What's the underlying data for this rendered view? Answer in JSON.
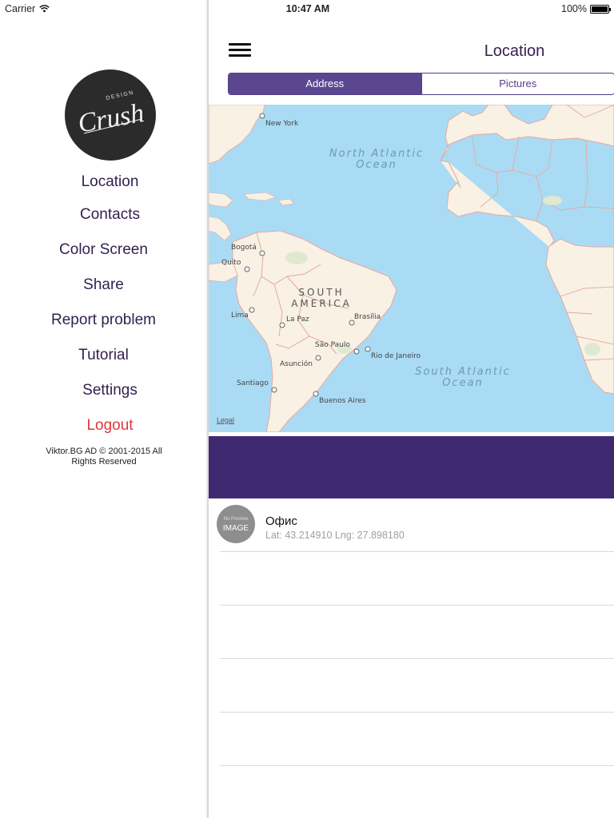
{
  "status_bar": {
    "carrier": "Carrier",
    "time": "10:47 AM",
    "battery": "100%",
    "battery_level": 1.0
  },
  "sidebar": {
    "logo_text_top": "DESIGN",
    "logo_text_main": "Crush",
    "items": [
      {
        "label": "Location"
      },
      {
        "label": "Contacts"
      },
      {
        "label": "Color Screen"
      },
      {
        "label": "Share"
      },
      {
        "label": "Report problem"
      },
      {
        "label": "Tutorial"
      },
      {
        "label": "Settings"
      },
      {
        "label": "Logout"
      }
    ],
    "copyright": "Viktor.BG AD © 2001-2015 All Rights Reserved"
  },
  "header": {
    "title": "Location"
  },
  "segments": {
    "address": "Address",
    "pictures": "Pictures",
    "selected": "Address"
  },
  "map": {
    "labels": {
      "north_atlantic_1": "North Atlantic",
      "north_atlantic_2": "Ocean",
      "south_atlantic_1": "South Atlantic",
      "south_atlantic_2": "Ocean",
      "south_america_1": "SOUTH",
      "south_america_2": "AMERICA",
      "new_york": "New York",
      "bogota": "Bogotá",
      "quito": "Quito",
      "lima": "Lima",
      "la_paz": "La Paz",
      "brasilia": "Brasília",
      "sao_paulo": "São Paulo",
      "rio": "Rio de Janeiro",
      "asuncion": "Asunción",
      "santiago": "Santiago",
      "buenos_aires": "Buenos Aires"
    },
    "legal": "Legal",
    "water_color": "#aadbf5",
    "land_color": "#f8f1e4",
    "border_color": "#e6a8a0"
  },
  "locations": [
    {
      "avatar_top": "No Preview",
      "avatar_main": "IMAGE",
      "name": "Офис",
      "coords": "Lat: 43.214910 Lng: 27.898180"
    }
  ],
  "colors": {
    "accent": "#5b4790",
    "banner": "#3f2a72",
    "menu_text": "#33214f",
    "logout": "#e0363b"
  }
}
